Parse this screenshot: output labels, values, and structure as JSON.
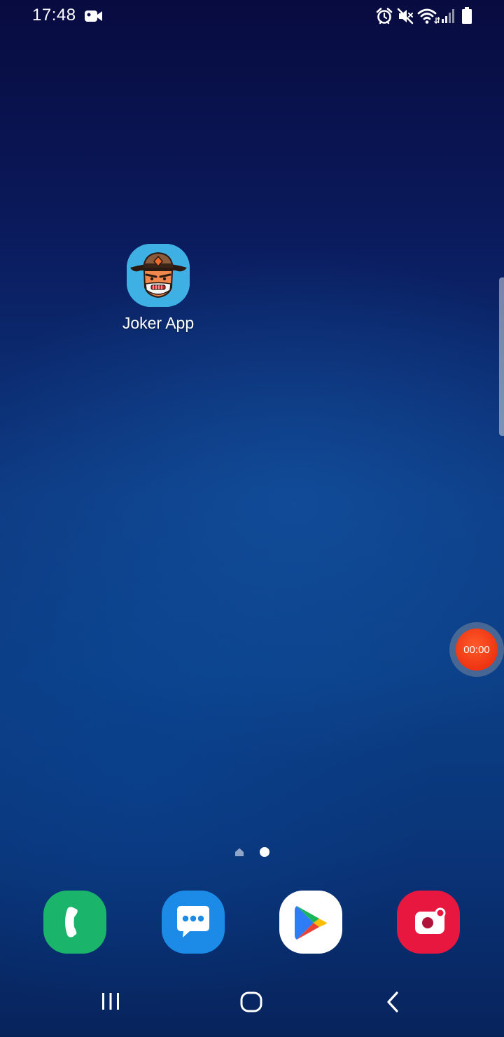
{
  "status_bar": {
    "time": "17:48",
    "left_icons": [
      "video-camera-icon"
    ],
    "right_icons": [
      "alarm-icon",
      "mute-icon",
      "wifi-icon",
      "signal-icon",
      "battery-icon"
    ]
  },
  "home": {
    "apps": [
      {
        "label": "Joker App",
        "icon": "joker-app-icon",
        "icon_bg": "#3fb0e4"
      }
    ]
  },
  "recorder": {
    "timer": "00:00",
    "color": "#ee3412"
  },
  "page_indicator": {
    "pages": [
      "home-page",
      "page-2"
    ],
    "current_page": 2
  },
  "dock": {
    "apps": [
      {
        "name": "Phone",
        "icon": "phone-icon",
        "color": "#1bb46b"
      },
      {
        "name": "Messages",
        "icon": "messages-icon",
        "color": "#1c8be8"
      },
      {
        "name": "Play Store",
        "icon": "play-store-icon",
        "color": "#ffffff"
      },
      {
        "name": "Screen Recorder",
        "icon": "screen-recorder-icon",
        "color": "#e8173f"
      }
    ]
  },
  "nav_bar": {
    "buttons": [
      "recent-apps",
      "home",
      "back"
    ]
  }
}
